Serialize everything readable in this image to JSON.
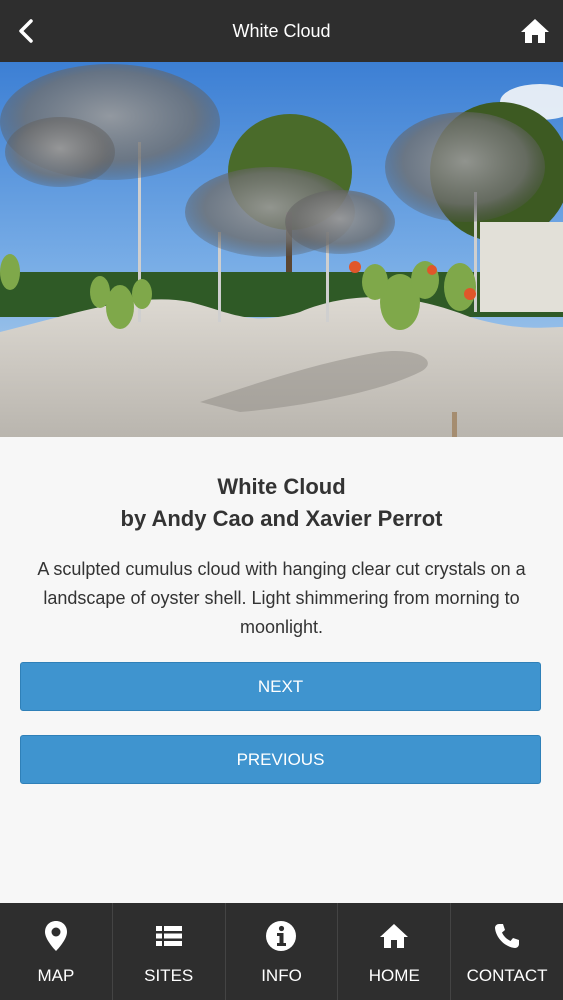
{
  "header": {
    "title": "White Cloud",
    "back_icon": "chevron-left-icon",
    "home_icon": "home-icon"
  },
  "hero": {
    "description": "photo"
  },
  "artwork": {
    "title": "White Cloud",
    "byline": "by Andy Cao and Xavier Perrot",
    "description": "A sculpted cumulus cloud with hanging clear cut crystals on a landscape of oyster shell. Light shimmering from morning to moonlight."
  },
  "buttons": {
    "next_label": "NEXT",
    "previous_label": "PREVIOUS",
    "color": "#3f94cf"
  },
  "tabbar": {
    "items": [
      {
        "label": "MAP",
        "icon": "map-pin-icon"
      },
      {
        "label": "SITES",
        "icon": "list-icon"
      },
      {
        "label": "INFO",
        "icon": "info-icon"
      },
      {
        "label": "HOME",
        "icon": "home-icon"
      },
      {
        "label": "CONTACT",
        "icon": "phone-icon"
      }
    ],
    "background": "#2e2e2e"
  }
}
